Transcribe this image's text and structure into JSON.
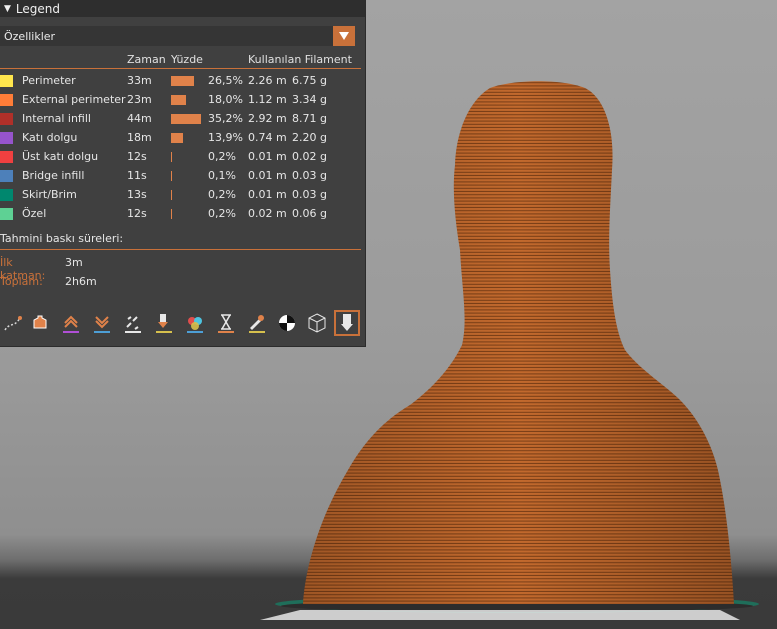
{
  "legend": {
    "title": "Legend",
    "view_type": "Özellikler",
    "columns": {
      "time": "Zaman",
      "percent": "Yüzde",
      "filament": "Kullanılan Filament"
    },
    "features": [
      {
        "name": "Perimeter",
        "color": "#ffe64d",
        "time": "33m",
        "percent": "26,5%",
        "fraction": 0.265,
        "length": "2.26 m",
        "weight": "6.75 g"
      },
      {
        "name": "External perimeter",
        "color": "#ff7d38",
        "time": "23m",
        "percent": "18,0%",
        "fraction": 0.18,
        "length": "1.12 m",
        "weight": "3.34 g"
      },
      {
        "name": "Internal infill",
        "color": "#b03029",
        "time": "44m",
        "percent": "35,2%",
        "fraction": 0.352,
        "length": "2.92 m",
        "weight": "8.71 g"
      },
      {
        "name": "Katı dolgu",
        "color": "#9654cc",
        "time": "18m",
        "percent": "13,9%",
        "fraction": 0.139,
        "length": "0.74 m",
        "weight": "2.20 g"
      },
      {
        "name": "Üst katı dolgu",
        "color": "#f04040",
        "time": "12s",
        "percent": "0,2%",
        "fraction": 0.002,
        "length": "0.01 m",
        "weight": "0.02 g"
      },
      {
        "name": "Bridge infill",
        "color": "#4d80ba",
        "time": "11s",
        "percent": "0,1%",
        "fraction": 0.001,
        "length": "0.01 m",
        "weight": "0.03 g"
      },
      {
        "name": "Skirt/Brim",
        "color": "#00876e",
        "time": "13s",
        "percent": "0,2%",
        "fraction": 0.002,
        "length": "0.01 m",
        "weight": "0.03 g"
      },
      {
        "name": "Özel",
        "color": "#5ed194",
        "time": "12s",
        "percent": "0,2%",
        "fraction": 0.002,
        "length": "0.02 m",
        "weight": "0.06 g"
      }
    ],
    "estimate_title": "Tahmini baskı süreleri:",
    "first_layer_label": "İlk katman:",
    "first_layer_value": "3m",
    "total_label": "Toplam:",
    "total_value": "2h6m"
  },
  "toolbar": {
    "icons": [
      "travel-icon",
      "wipe-icon",
      "retractions-icon",
      "deretractions-icon",
      "seams-icon",
      "tool-changes-icon",
      "color-changes-icon",
      "pause-prints-icon",
      "custom-gcodes-icon",
      "center-of-gravity-icon",
      "shells-icon",
      "tool-marker-icon"
    ]
  },
  "colors": {
    "accent": "#c9713a",
    "model": "#c0672b",
    "panel": "#404040"
  }
}
